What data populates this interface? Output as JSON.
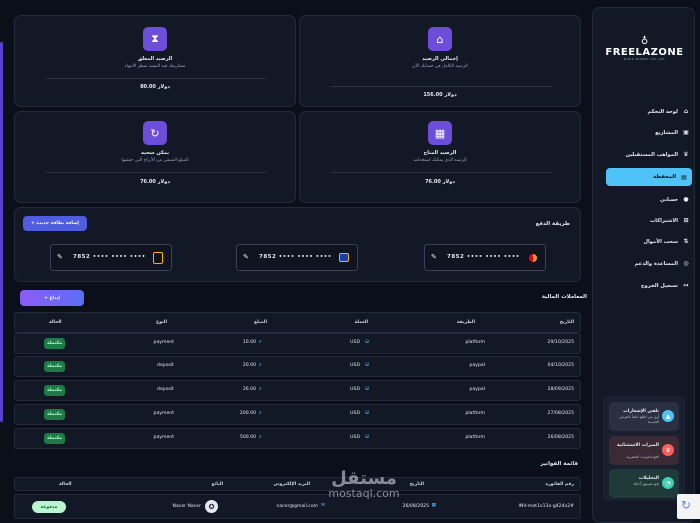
{
  "colors": {
    "accent": "#6c4ed8",
    "active_nav": "#4fc3f7",
    "badge_green": "#1e7a46",
    "background": "#0b0f1a",
    "card": "#121826"
  },
  "brand": {
    "name": "FREELAZONE",
    "tagline": "WORK WHERE YOU ARE"
  },
  "sidebar": {
    "items": [
      {
        "label": "لوحة التحكم",
        "icon": "dashboard-icon"
      },
      {
        "label": "المشاريع",
        "icon": "projects-icon"
      },
      {
        "label": "المواهب المستقبلين",
        "icon": "crown-icon"
      },
      {
        "label": "المحفظة",
        "icon": "wallet-icon",
        "active": true
      },
      {
        "label": "حسابي",
        "icon": "user-icon"
      },
      {
        "label": "الاشتراكات",
        "icon": "subscriptions-icon"
      },
      {
        "label": "سحب الأموال",
        "icon": "withdraw-icon"
      },
      {
        "label": "المساعدة والدعم",
        "icon": "help-icon"
      },
      {
        "label": "تسجيل الخروج",
        "icon": "logout-icon"
      }
    ],
    "promos": [
      {
        "title": "تلقي الإشعارات",
        "desc": "أول من اطلع دائماً بالفرص الجديدة",
        "icon": "bell-icon"
      },
      {
        "title": "الميزات الاستثنائية",
        "desc": "افتح الميزات الحصرية",
        "icon": "crown-icon"
      },
      {
        "title": "التحليلات",
        "desc": "تابع مستوى أدائك",
        "icon": "chart-icon"
      }
    ]
  },
  "balances": [
    {
      "title": "إجمالي الرصيد",
      "desc": "الرصيد الكامل في حسابك الآن",
      "value": "156.00 دولار",
      "icon": "bank-icon"
    },
    {
      "title": "الرصيد المعلق",
      "desc": "مشاريعك قيد التنفيذ تنتظر الانتهاء",
      "value": "80.00 دولار",
      "icon": "hourglass-icon"
    },
    {
      "title": "الرصيد المتاح",
      "desc": "الرصيد الذي يمكنك استخدامه",
      "value": "76.00 دولار",
      "icon": "calendar-check-icon"
    },
    {
      "title": "يمكن سحبه",
      "desc": "المبلغ المتبقي من الأرباح التي حققتها",
      "value": "76.00 دولار",
      "icon": "refresh-icon"
    }
  ],
  "payment": {
    "title": "طريقة الدفع",
    "add_label": "+ إضافة بطاقة جديدة",
    "cards": [
      {
        "number": "7852 •••• •••• ••••",
        "brand": "mastercard"
      },
      {
        "number": "7852 •••• •••• ••••",
        "brand": "visa"
      },
      {
        "number": "7852 •••• •••• ••••",
        "brand": "wallet"
      }
    ]
  },
  "transactions": {
    "title": "المعاملات المالية",
    "deposit_label": "+ إيداع",
    "headers": [
      "التاريخ",
      "الطريقة",
      "العملة",
      "المبلغ",
      "النوع",
      "الحالة"
    ],
    "rows": [
      {
        "date": "29/10/2025",
        "method": "platform",
        "currency": "USD",
        "amount": "10.00",
        "type": "payment",
        "status": "مكتملة"
      },
      {
        "date": "04/10/2025",
        "method": "paypal",
        "currency": "USD",
        "amount": "20.00",
        "type": "deposit",
        "status": "مكتملة"
      },
      {
        "date": "28/09/2025",
        "method": "paypal",
        "currency": "USD",
        "amount": "26.00",
        "type": "deposit",
        "status": "مكتملة"
      },
      {
        "date": "27/08/2025",
        "method": "platform",
        "currency": "USD",
        "amount": "200.00",
        "type": "payment",
        "status": "مكتملة"
      },
      {
        "date": "26/08/2025",
        "method": "platform",
        "currency": "USD",
        "amount": "500.00",
        "type": "payment",
        "status": "مكتملة"
      }
    ]
  },
  "invoices": {
    "title": "قائمة الفواتير",
    "headers": [
      "رقم الفاتورة",
      "التاريخ",
      "البريد الإلكتروني",
      "البائع",
      "الحالة"
    ],
    "rows": [
      {
        "number": "INV-met1v13x-g424x2#",
        "date": "26/08/2025",
        "email": "nacer@gmail.com",
        "seller": "Nacer Nacer",
        "status": "مدفوعة"
      }
    ]
  },
  "watermark": {
    "arabic": "مستقل",
    "latin": "mostaql.com"
  }
}
